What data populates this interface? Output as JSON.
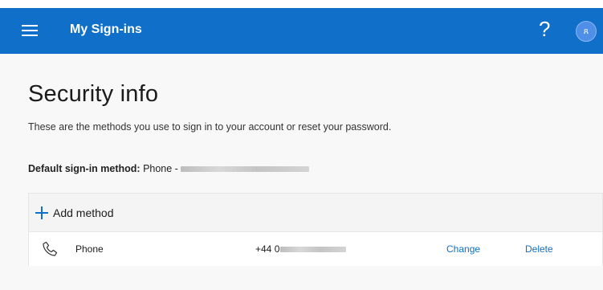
{
  "header": {
    "app_title": "My Sign-ins",
    "help_label": "?",
    "avatar_initial": "ጸ",
    "brand_color": "#0f6fc9"
  },
  "page": {
    "title": "Security info",
    "subtitle": "These are the methods you use to sign in to your account or reset your password.",
    "default_method_label": "Default sign-in method:",
    "default_method_value": "Phone -"
  },
  "methods": {
    "add_label": "Add method",
    "add_icon": "plus-icon",
    "items": [
      {
        "icon": "phone-icon",
        "name": "Phone",
        "value_prefix": "+44 0",
        "change_label": "Change",
        "delete_label": "Delete"
      }
    ]
  }
}
